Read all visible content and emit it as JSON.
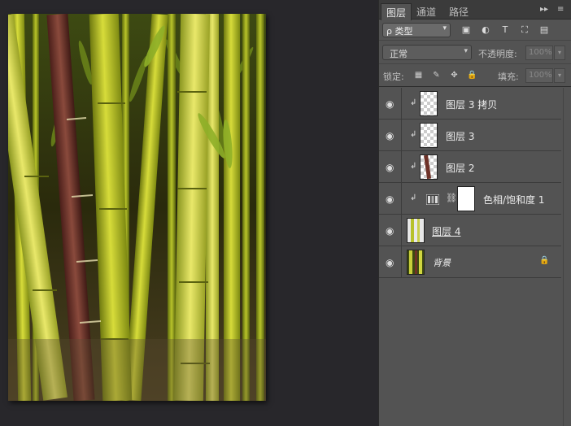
{
  "panel": {
    "tabs": [
      "图层",
      "通道",
      "路径"
    ],
    "tab_controls": [
      "▸▸",
      "≡"
    ],
    "filter": {
      "label": "类型",
      "search_glyph": "ρ"
    },
    "filter_icons": [
      "▣",
      "◐",
      "T",
      "⛶",
      "▤"
    ],
    "blend_mode": "正常",
    "opacity_label": "不透明度:",
    "opacity_value": "100%",
    "lock_label": "锁定:",
    "lock_icons": [
      "▦",
      "✎",
      "✥",
      "🔒"
    ],
    "fill_label": "填充:",
    "fill_value": "100%",
    "dropdown_arrow": "▾"
  },
  "layers": [
    {
      "name": "图层 3 拷贝",
      "clipped": true,
      "thumb": "transparent"
    },
    {
      "name": "图层 3",
      "clipped": true,
      "thumb": "transparent"
    },
    {
      "name": "图层 2",
      "clipped": true,
      "thumb": "stalk"
    },
    {
      "name": "色相/饱和度 1",
      "clipped": true,
      "thumb": "adjustment"
    },
    {
      "name": "图层 4",
      "clipped": false,
      "thumb": "bamboo"
    },
    {
      "name": "背景",
      "clipped": false,
      "thumb": "bamboo-dark",
      "locked": true
    }
  ],
  "glyphs": {
    "eye": "◉",
    "clip": "↲",
    "link": "⛓",
    "lock": "🔒"
  },
  "colors": {
    "panel_bg": "#535353",
    "canvas_bg": "#28272b",
    "bamboo_green": "#b7c12a",
    "bamboo_stalk_red": "#6e3228"
  }
}
